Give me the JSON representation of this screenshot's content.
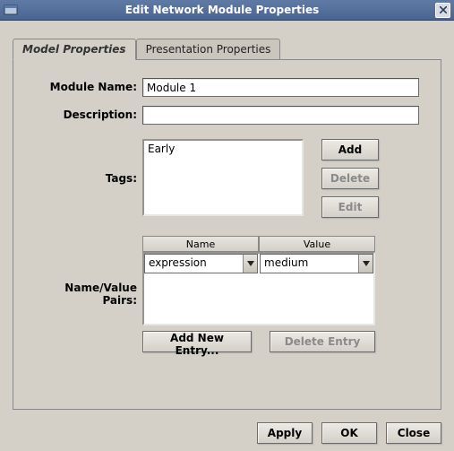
{
  "window": {
    "title": "Edit Network Module Properties"
  },
  "tabs": {
    "model": "Model Properties",
    "presentation": "Presentation Properties"
  },
  "labels": {
    "moduleName": "Module Name:",
    "description": "Description:",
    "tags": "Tags:",
    "nvpairs": "Name/Value Pairs:"
  },
  "fields": {
    "moduleName": "Module 1",
    "description": ""
  },
  "tags": {
    "items": [
      "Early"
    ],
    "buttons": {
      "add": "Add",
      "delete": "Delete",
      "edit": "Edit"
    }
  },
  "nv": {
    "headers": {
      "name": "Name",
      "value": "Value"
    },
    "row": {
      "name": "expression",
      "value": "medium"
    },
    "buttons": {
      "addNew": "Add New Entry...",
      "delete": "Delete Entry"
    }
  },
  "dialogButtons": {
    "apply": "Apply",
    "ok": "OK",
    "close": "Close"
  }
}
